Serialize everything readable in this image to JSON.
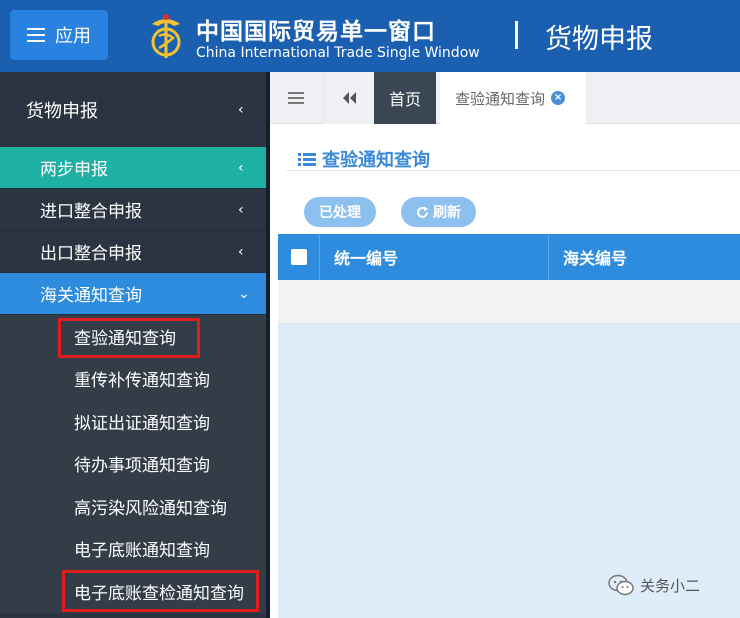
{
  "header": {
    "app_label": "应用",
    "brand_cn": "中国国际贸易单一窗口",
    "brand_en": "China International Trade Single Window",
    "module_title": "货物申报"
  },
  "sidebar": {
    "top_label": "货物申报",
    "items": [
      {
        "label": "两步申报",
        "state": "teal"
      },
      {
        "label": "进口整合申报",
        "state": "normal"
      },
      {
        "label": "出口整合申报",
        "state": "normal"
      },
      {
        "label": "海关通知查询",
        "state": "expanded"
      }
    ],
    "sub_items": [
      {
        "label": "查验通知查询",
        "highlighted": true
      },
      {
        "label": "重传补传通知查询",
        "highlighted": false
      },
      {
        "label": "拟证出证通知查询",
        "highlighted": false
      },
      {
        "label": "待办事项通知查询",
        "highlighted": false
      },
      {
        "label": "高污染风险通知查询",
        "highlighted": false
      },
      {
        "label": "电子底账通知查询",
        "highlighted": false
      },
      {
        "label": "电子底账查检通知查询",
        "highlighted": true
      }
    ]
  },
  "tabs": {
    "home": "首页",
    "active": "查验通知查询"
  },
  "page": {
    "title": "查验通知查询",
    "buttons": {
      "processed": "已处理",
      "refresh": "刷新"
    },
    "table": {
      "columns": [
        "统一编号",
        "海关编号"
      ]
    }
  },
  "watermark": "关务小二",
  "colors": {
    "header_bg": "#1a5fb0",
    "sidebar_bg": "#2b3541",
    "teal": "#1fb0a4",
    "accent_blue": "#2d8cdd",
    "highlight_red": "#e01d1d"
  }
}
